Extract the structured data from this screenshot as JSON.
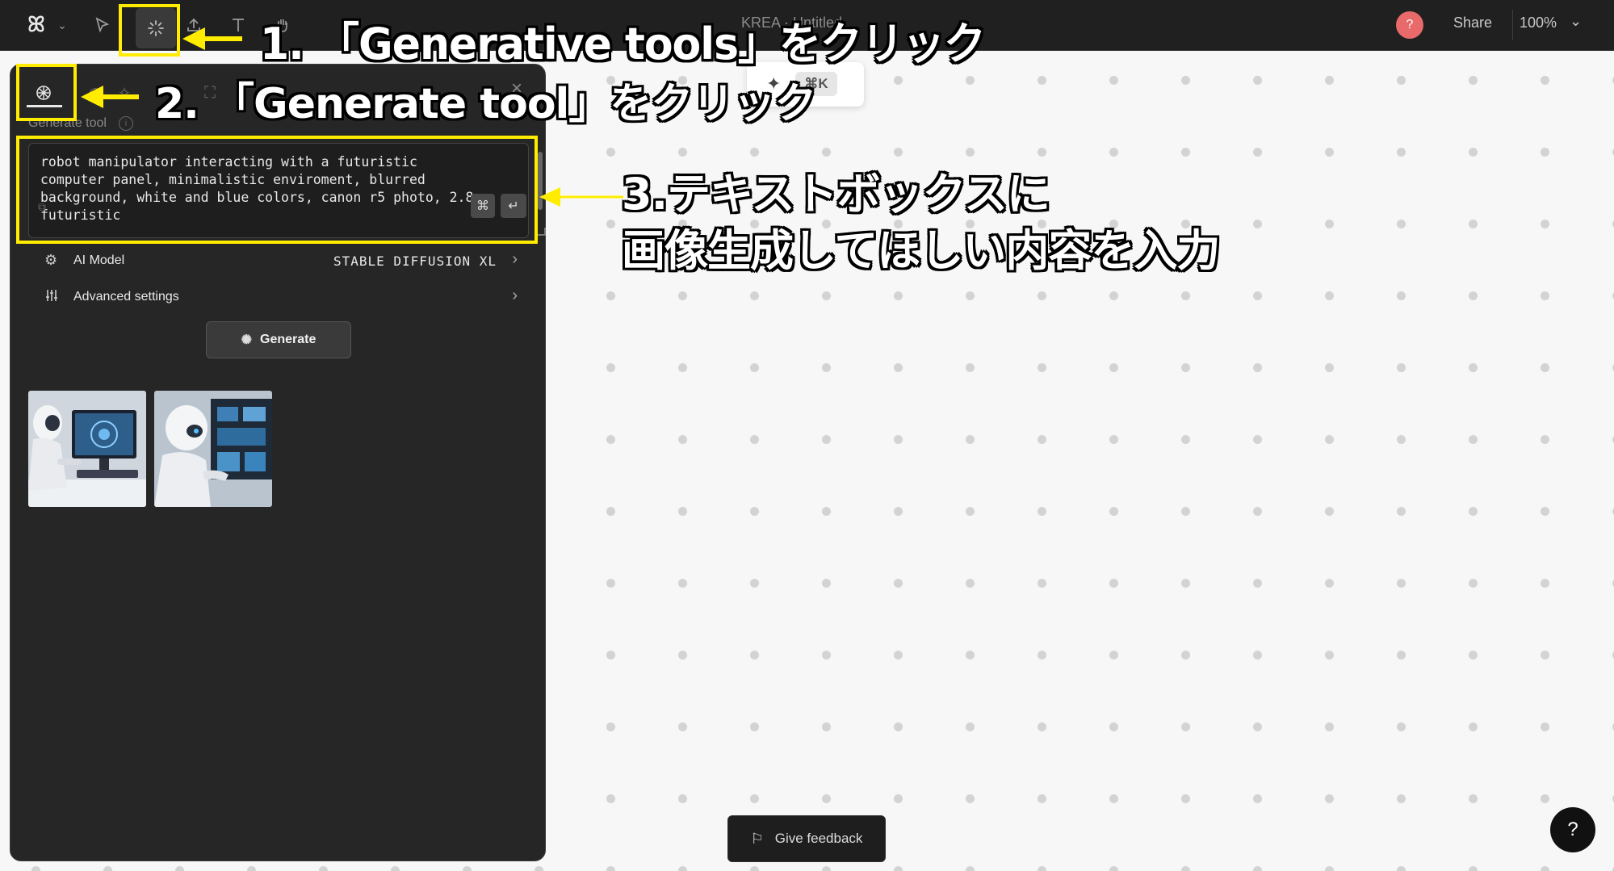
{
  "topbar": {
    "logo": "ꕤ",
    "doc_title": "KREA · Untitled",
    "avatar_label": "?",
    "share_label": "Share",
    "zoom_label": "100%"
  },
  "cmdk": {
    "shortcut": "⌘K"
  },
  "panel": {
    "title": "Generate tool",
    "close_label": "×",
    "prompt_value": "robot manipulator interacting with a futuristic computer panel, minimalistic enviroment, blurred background, white and blue colors, canon r5 photo, 2.8, futuristic",
    "cmd_key": "⌘",
    "enter_key": "↵",
    "ai_model_label": "AI Model",
    "ai_model_value": "STABLE DIFFUSION XL",
    "advanced_label": "Advanced settings",
    "generate_label": "Generate"
  },
  "annotations": {
    "step1": "1. 「Generative tools」をクリック",
    "step2": "2. 「Generate tool」をクリック",
    "step3_line1": "3.テキストボックスに",
    "step3_line2": "画像生成してほしい内容を入力"
  },
  "bottom": {
    "feedback_label": "Give feedback",
    "help_label": "?"
  },
  "colors": {
    "annotation_yellow": "#ffec00",
    "panel_bg": "#262626",
    "topbar_bg": "#202020"
  }
}
